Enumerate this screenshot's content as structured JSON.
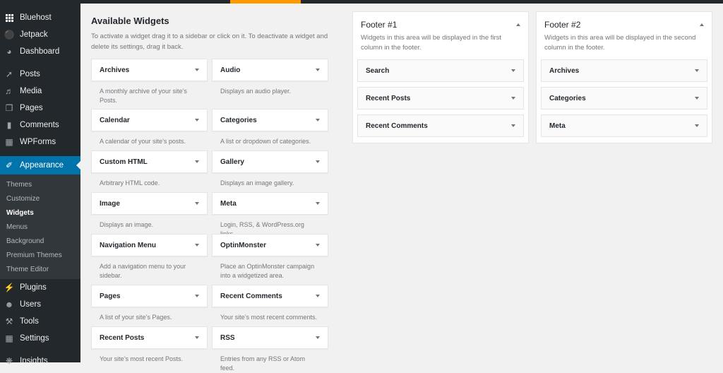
{
  "admin_bar": {
    "accent_color": "#ff9900"
  },
  "sidebar": {
    "items_top": [
      {
        "label": "Bluehost",
        "icon": "grid-icon"
      },
      {
        "label": "Jetpack",
        "icon": "jetpack-icon"
      },
      {
        "label": "Dashboard",
        "icon": "dashboard-icon"
      }
    ],
    "items_mid": [
      {
        "label": "Posts",
        "icon": "pin-icon"
      },
      {
        "label": "Media",
        "icon": "media-icon"
      },
      {
        "label": "Pages",
        "icon": "pages-icon"
      },
      {
        "label": "Comments",
        "icon": "comment-icon"
      },
      {
        "label": "WPForms",
        "icon": "form-icon"
      }
    ],
    "active_item": {
      "label": "Appearance",
      "icon": "paintbrush-icon"
    },
    "submenu": [
      {
        "label": "Themes"
      },
      {
        "label": "Customize"
      },
      {
        "label": "Widgets",
        "current": true
      },
      {
        "label": "Menus"
      },
      {
        "label": "Background"
      },
      {
        "label": "Premium Themes"
      },
      {
        "label": "Theme Editor"
      }
    ],
    "items_bottom": [
      {
        "label": "Plugins",
        "icon": "plugin-icon"
      },
      {
        "label": "Users",
        "icon": "user-icon"
      },
      {
        "label": "Tools",
        "icon": "wrench-icon"
      },
      {
        "label": "Settings",
        "icon": "settings-icon"
      },
      {
        "label": "Insights",
        "icon": "insights-icon"
      }
    ],
    "active_color": "#0073aa"
  },
  "available_widgets": {
    "title": "Available Widgets",
    "description": "To activate a widget drag it to a sidebar or click on it. To deactivate a widget and delete its settings, drag it back.",
    "widgets": [
      {
        "name": "Archives",
        "desc": "A monthly archive of your site’s Posts."
      },
      {
        "name": "Audio",
        "desc": "Displays an audio player."
      },
      {
        "name": "Calendar",
        "desc": "A calendar of your site’s posts."
      },
      {
        "name": "Categories",
        "desc": "A list or dropdown of categories."
      },
      {
        "name": "Custom HTML",
        "desc": "Arbitrary HTML code."
      },
      {
        "name": "Gallery",
        "desc": "Displays an image gallery."
      },
      {
        "name": "Image",
        "desc": "Displays an image."
      },
      {
        "name": "Meta",
        "desc": "Login, RSS, & WordPress.org links."
      },
      {
        "name": "Navigation Menu",
        "desc": "Add a navigation menu to your sidebar."
      },
      {
        "name": "OptinMonster",
        "desc": "Place an OptinMonster campaign into a widgetized area."
      },
      {
        "name": "Pages",
        "desc": "A list of your site’s Pages."
      },
      {
        "name": "Recent Comments",
        "desc": "Your site’s most recent comments."
      },
      {
        "name": "Recent Posts",
        "desc": "Your site’s most recent Posts."
      },
      {
        "name": "RSS",
        "desc": "Entries from any RSS or Atom feed."
      }
    ]
  },
  "widget_areas": [
    {
      "title": "Footer #1",
      "description": "Widgets in this area will be displayed in the first column in the footer.",
      "widgets": [
        "Search",
        "Recent Posts",
        "Recent Comments"
      ]
    },
    {
      "title": "Footer #2",
      "description": "Widgets in this area will be displayed in the second column in the footer.",
      "widgets": [
        "Archives",
        "Categories",
        "Meta"
      ]
    }
  ]
}
